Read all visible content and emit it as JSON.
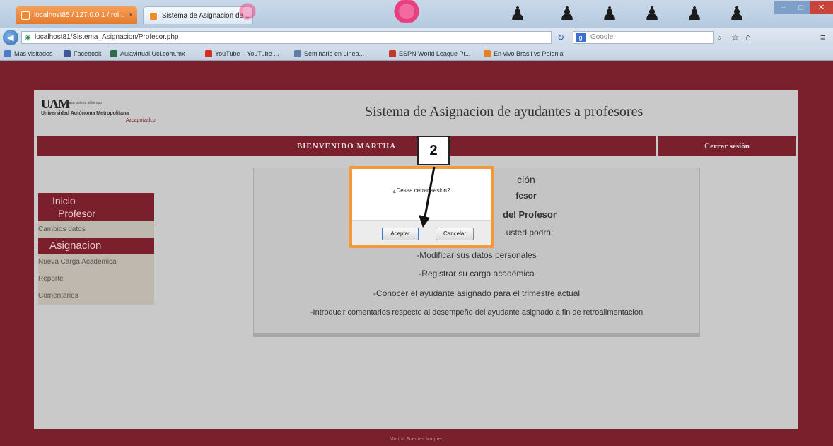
{
  "browser": {
    "tabs": [
      {
        "label": "localhost85 / 127.0.0.1 / rol..."
      },
      {
        "label": "Sistema de Asignación de ..."
      }
    ],
    "url": "localhost81/Sistema_Asignacion/Profesor.php",
    "search_placeholder": "Google",
    "bookmarks": [
      {
        "label": "Mas visitados",
        "color": "#4a7ac8"
      },
      {
        "label": "Facebook",
        "color": "#3b5998"
      },
      {
        "label": "Aulavirtual.Uci.com.mx",
        "color": "#2c6e49"
      },
      {
        "label": "YouTube – YouTube ...",
        "color": "#d62d20"
      },
      {
        "label": "Seminario en Linea...",
        "color": "#5c7fa3"
      },
      {
        "label": "ESPN World League Pr...",
        "color": "#c0392b"
      },
      {
        "label": "En vivo Brasil vs Polonia",
        "color": "#e67e22"
      }
    ]
  },
  "header": {
    "logo_mark": "UAM",
    "logo_tagline": "Casa abierta al tiempo",
    "logo_name": "Universidad Autónoma Metropolitana",
    "logo_campus": "Azcapotzalco",
    "site_title": "Sistema de Asignacion de ayudantes a profesores",
    "welcome": "BIENVENIDO MARTHA",
    "logout": "Cerrar sesión"
  },
  "sidebar": {
    "section1_line1": "Inicio",
    "section1_line2": "Profesor",
    "section1_items": [
      "Cambios datos"
    ],
    "section2": "Asignacion",
    "section2_items": [
      "Nueva Carga Academica",
      "Reporte",
      "Comentarios"
    ]
  },
  "content": {
    "heading": "ción",
    "sub": "fesor",
    "sub2": "del Profesor",
    "intro": "usted podrá:",
    "lines": [
      "-Modificar sus datos personales",
      "-Registrar su carga académica",
      "-Conocer el ayudante asignado para el trimestre actual",
      "-Introducir comentarios respecto al desempeño del ayudante asignado a fin de retroalimentacion"
    ]
  },
  "dialog": {
    "message": "¿Desea cerrar sesion?",
    "ok_label": "Aceptar",
    "cancel_label": "Cancelar"
  },
  "callout": {
    "number": "2"
  },
  "footer": {
    "text": "Martha Fuentes Maqueo"
  },
  "colors": {
    "accent": "#7a1f2c",
    "dialog_border": "#f29a3a"
  }
}
